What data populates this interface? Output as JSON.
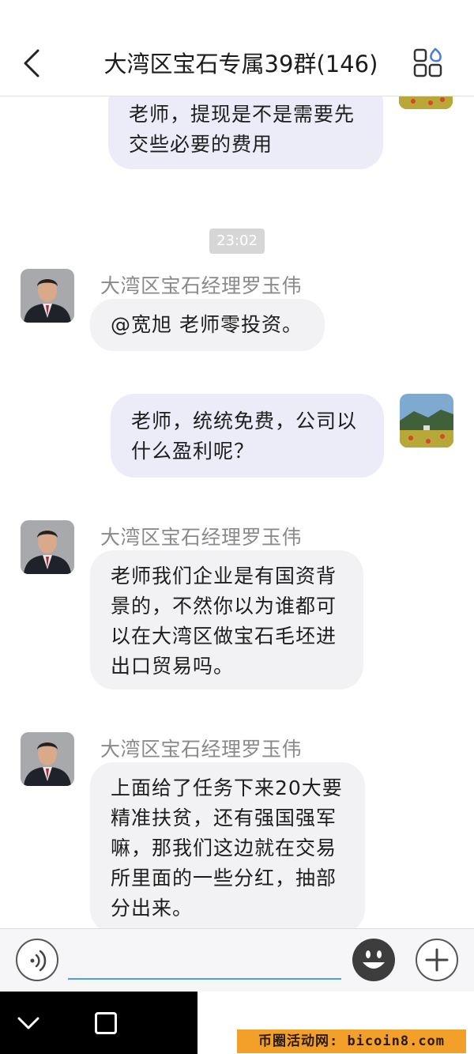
{
  "header": {
    "title": "大湾区宝石专属39群(146)",
    "back_icon": "chevron-left-icon",
    "menu_icon": "apps-grid-icon"
  },
  "messages": [
    {
      "side": "me",
      "text_lines": [
        "老师，提现是不是需要先",
        "交些必要的费用"
      ]
    },
    {
      "type": "time",
      "text": "23:02"
    },
    {
      "side": "other",
      "sender": "大湾区宝石经理罗玉伟",
      "text_lines": [
        "@宽旭 老师零投资。"
      ]
    },
    {
      "side": "me",
      "text_lines": [
        "老师，统统免费，公司以",
        "什么盈利呢？"
      ]
    },
    {
      "side": "other",
      "sender": "大湾区宝石经理罗玉伟",
      "text_lines": [
        "老师我们企业是有国资背",
        "景的，不然你以为谁都可",
        "以在大湾区做宝石毛坯进",
        "出口贸易吗。"
      ]
    },
    {
      "side": "other",
      "sender": "大湾区宝石经理罗玉伟",
      "text_lines": [
        "上面给了任务下来20大要",
        "精准扶贫，还有强国强军",
        "嘛，那我们这边就在交易",
        "所里面的一些分红，抽部",
        "分出来。"
      ]
    }
  ],
  "input": {
    "value": "",
    "voice_icon": "voice-icon",
    "emoji_icon": "emoji-icon",
    "plus_icon": "plus-icon"
  },
  "system_nav": {
    "back_icon": "nav-back-icon",
    "recent_icon": "nav-recent-icon"
  },
  "watermark": "币圈活动网: bicoin8.com",
  "colors": {
    "my_bubble": "#ececf9",
    "other_bubble": "#f2f2f4",
    "input_underline": "#4aa3df",
    "watermark_bg": "#f2a02a"
  }
}
